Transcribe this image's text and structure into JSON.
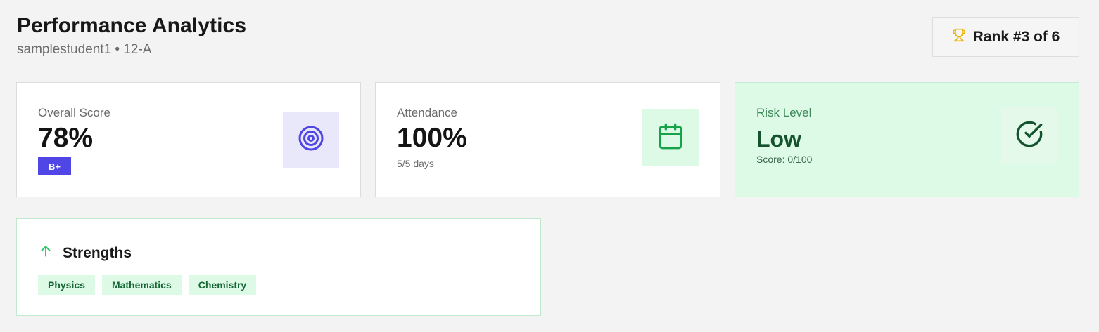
{
  "header": {
    "title": "Performance Analytics",
    "subtitle": "samplestudent1 • 12-A"
  },
  "rank": {
    "label": "Rank #3 of 6",
    "icon": "trophy-icon"
  },
  "cards": {
    "overall": {
      "label": "Overall Score",
      "value": "78%",
      "grade": "B+",
      "icon": "target-icon"
    },
    "attendance": {
      "label": "Attendance",
      "value": "100%",
      "detail": "5/5 days",
      "icon": "calendar-icon"
    },
    "risk": {
      "label": "Risk Level",
      "value": "Low",
      "detail": "Score: 0/100",
      "icon": "check-circle-icon"
    }
  },
  "strengths": {
    "title": "Strengths",
    "icon": "arrow-up-icon",
    "tags": [
      "Physics",
      "Mathematics",
      "Chemistry"
    ]
  },
  "colors": {
    "accent": "#4f46e5",
    "success": "#16a34a",
    "trophy": "#eab308"
  }
}
